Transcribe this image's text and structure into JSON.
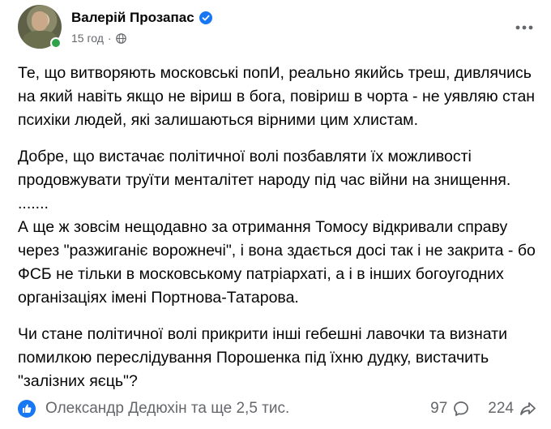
{
  "post": {
    "author": "Валерій Прозапас",
    "time": "15 год",
    "meta_separator": "·",
    "paragraphs": [
      "Те, що витворяють московські попИ, реально якийсь треш, дивлячись на який навіть якщо не віриш в бога, повіриш в чорта - не уявляю стан психіки людей, які залишаються вірними цим хлистам.",
      "Добре, що вистачає політичної волі позбавляти їх можливості продовжувати труїти менталітет народу під час війни на знищення.",
      ".......",
      "А ще ж зовсім нещодавно за отримання Томосу відкривали справу через \"разжиганіє ворожнечі\", і вона здається досі так і не закрита - бо ФСБ не тільки в московському патріархаті, а і в інших богоугодних організаціях імені Портнова-Татарова.",
      "Чи стане політичної волі прикрити інші гебешні лавочки та визнати помилкою переслідування Порошенка під їхню дудку, вистачить \"залізних яєць\"?"
    ]
  },
  "footer": {
    "reactions_text": "Олександр Дедюхін та ще 2,5 тис.",
    "comments_count": "97",
    "shares_count": "224"
  },
  "icons": {
    "verified": "verified-badge-icon",
    "globe": "globe-icon",
    "more": "more-options-icon",
    "like": "like-reaction-icon",
    "comment": "comment-icon",
    "share": "share-icon"
  },
  "colors": {
    "facebook_blue": "#1877f2",
    "secondary_text": "#65676b",
    "online_green": "#31a24c"
  }
}
